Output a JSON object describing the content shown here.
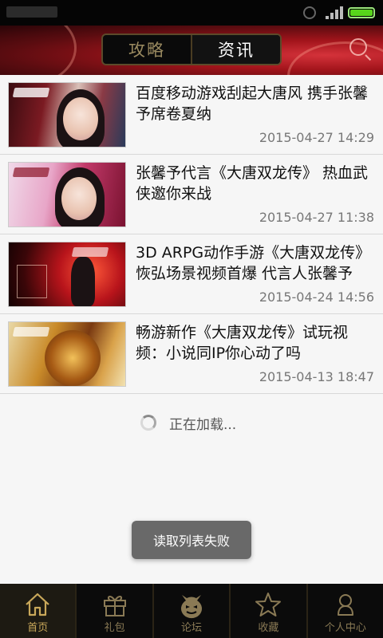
{
  "header": {
    "tabs": [
      {
        "label": "攻略",
        "active": false
      },
      {
        "label": "资讯",
        "active": true
      }
    ]
  },
  "articles": [
    {
      "title": "百度移动游戏刮起大唐风 携手张馨予席卷夏纳",
      "time": "2015-04-27 14:29"
    },
    {
      "title": "张馨予代言《大唐双龙传》 热血武侠邀你来战",
      "time": "2015-04-27 11:38"
    },
    {
      "title": "3D ARPG动作手游《大唐双龙传》恢弘场景视频首爆 代言人张馨予",
      "time": "2015-04-24 14:56"
    },
    {
      "title": "畅游新作《大唐双龙传》试玩视频：小说同IP你心动了吗",
      "time": "2015-04-13 18:47"
    }
  ],
  "loading": {
    "text": "正在加载..."
  },
  "toast": {
    "text": "读取列表失败"
  },
  "bottom_nav": [
    {
      "label": "首页",
      "icon": "home-icon",
      "active": true
    },
    {
      "label": "礼包",
      "icon": "gift-icon",
      "active": false
    },
    {
      "label": "论坛",
      "icon": "forum-mask-icon",
      "active": false
    },
    {
      "label": "收藏",
      "icon": "star-icon",
      "active": false
    },
    {
      "label": "个人中心",
      "icon": "person-icon",
      "active": false
    }
  ],
  "colors": {
    "header_red": "#a2141b",
    "nav_gold": "#c9a85a",
    "battery_green": "#57d51b"
  }
}
